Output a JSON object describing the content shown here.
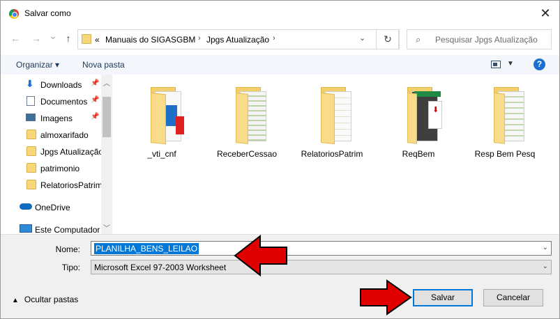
{
  "window": {
    "title": "Salvar como",
    "close_glyph": "✕"
  },
  "nav": {
    "back_glyph": "←",
    "forward_glyph": "→",
    "recent_glyph": "⌄",
    "up_glyph": "↑",
    "breadcrumb": [
      "«",
      "Manuais do SIGASGBM",
      "Jpgs Atualização"
    ],
    "search_placeholder": "Pesquisar Jpgs Atualização",
    "refresh_glyph": "↻"
  },
  "toolbar": {
    "organize": "Organizar ▾",
    "new_folder": "Nova pasta",
    "help": "?"
  },
  "sidebar": {
    "items": [
      {
        "label": "Downloads",
        "icon": "download-icon",
        "pinned": true
      },
      {
        "label": "Documentos",
        "icon": "documents-icon",
        "pinned": true
      },
      {
        "label": "Imagens",
        "icon": "pictures-icon",
        "pinned": true
      },
      {
        "label": "almoxarifado",
        "icon": "folder-icon",
        "pinned": false
      },
      {
        "label": "Jpgs Atualização",
        "icon": "folder-icon",
        "pinned": false
      },
      {
        "label": "patrimonio",
        "icon": "folder-icon",
        "pinned": false
      },
      {
        "label": "RelatoriosPatrim",
        "icon": "folder-icon",
        "pinned": false
      },
      {
        "label": "OneDrive",
        "icon": "cloud-icon",
        "pinned": false
      },
      {
        "label": "Este Computador",
        "icon": "computer-icon",
        "pinned": false
      }
    ]
  },
  "files": [
    {
      "name": "_vti_cnf"
    },
    {
      "name": "ReceberCessao"
    },
    {
      "name": "RelatoriosPatrim"
    },
    {
      "name": "ReqBem"
    },
    {
      "name": "Resp Bem Pesq"
    }
  ],
  "form": {
    "name_label": "Nome:",
    "name_value": "PLANILHA_BENS_LEILAO",
    "type_label": "Tipo:",
    "type_value": "Microsoft Excel 97-2003 Worksheet",
    "hide_folders": "Ocultar pastas",
    "save": "Salvar",
    "cancel": "Cancelar"
  },
  "colors": {
    "accent": "#0078d7",
    "arrow": "#e00000",
    "folder": "#f6d77a"
  }
}
